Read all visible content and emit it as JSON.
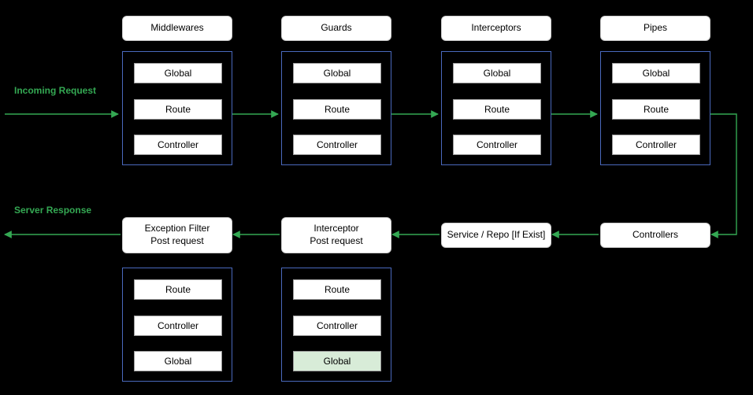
{
  "labels": {
    "incoming": "Incoming Request",
    "response": "Server Response"
  },
  "stage_labels": {
    "global": "Global",
    "route": "Route",
    "controller": "Controller"
  },
  "top_stages": [
    {
      "title": "Middlewares"
    },
    {
      "title": "Guards"
    },
    {
      "title": "Interceptors"
    },
    {
      "title": "Pipes"
    }
  ],
  "bottom_stages": {
    "controllers": {
      "title": "Controllers"
    },
    "service": {
      "title": "Service / Repo [If Exist]"
    },
    "interceptor_post": {
      "title_line1": "Interceptor",
      "title_line2": "Post request"
    },
    "exception_post": {
      "title_line1": "Exception Filter",
      "title_line2": "Post request"
    }
  },
  "chart_data": {
    "type": "flow",
    "direction": "request-response",
    "request_path": [
      "Incoming Request",
      "Middlewares [Global → Route → Controller]",
      "Guards [Global → Route → Controller]",
      "Interceptors [Global → Route → Controller]",
      "Pipes [Global → Route → Controller]",
      "Controllers",
      "Service / Repo [If Exist]"
    ],
    "response_path": [
      "Service / Repo [If Exist]",
      "Interceptor Post request [Route → Controller → Global]",
      "Exception Filter Post request [Route → Controller → Global]",
      "Server Response"
    ],
    "highlighted": "Interceptor Post request > Global"
  }
}
